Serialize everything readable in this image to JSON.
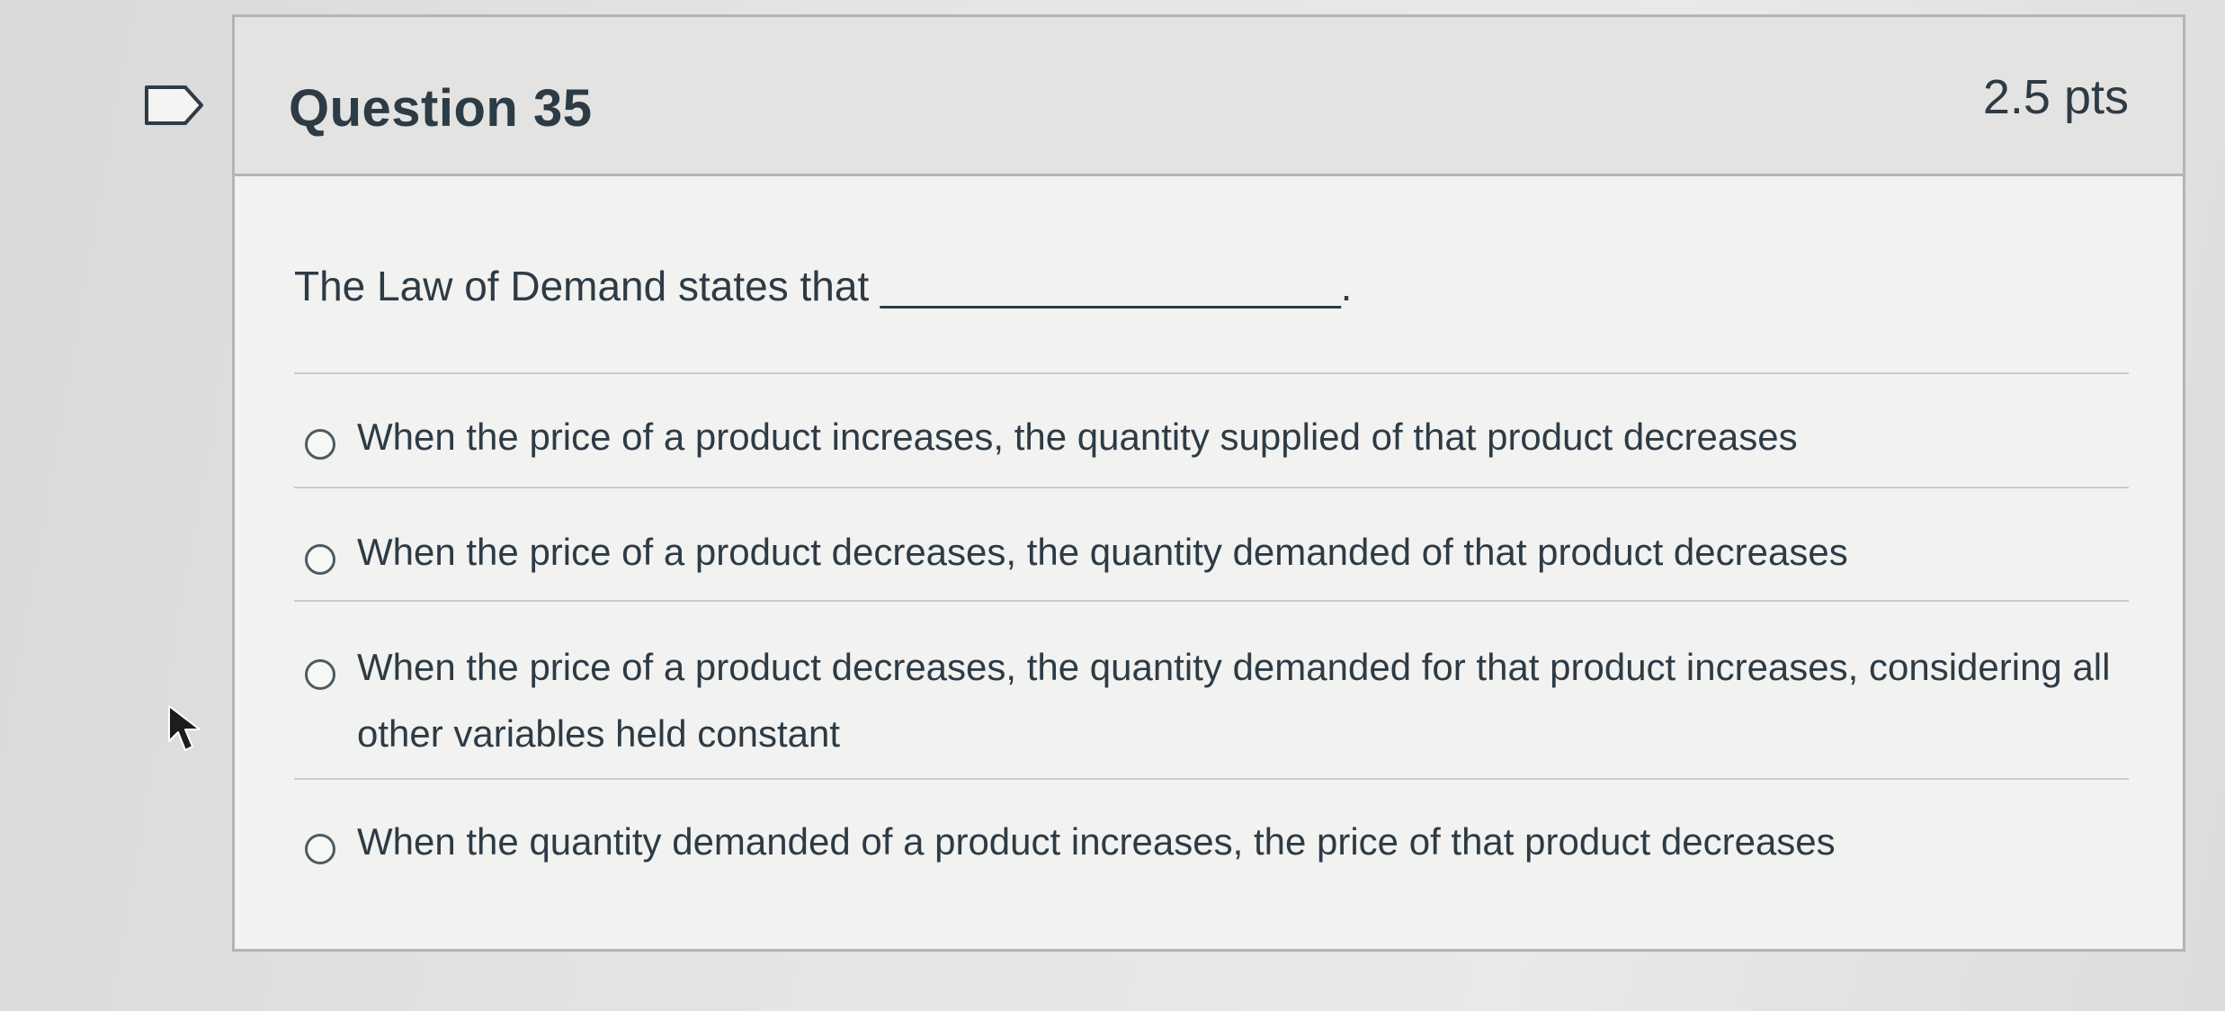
{
  "question": {
    "title": "Question 35",
    "points": "2.5 pts",
    "text": "The Law of Demand states that ____________________."
  },
  "answers": [
    {
      "label": "When the price of a product increases, the quantity supplied of that product decreases"
    },
    {
      "label": "When the price of a product decreases, the quantity demanded of that product decreases"
    },
    {
      "label": "When the price of a product decreases, the quantity demanded for that product increases, considering all other variables held constant"
    },
    {
      "label": "When the quantity demanded of a product increases, the price of that product decreases"
    }
  ],
  "icons": {
    "flag": "flag-icon",
    "cursor": "mouse-pointer-icon",
    "radio": "radio-button-icon"
  },
  "colors": {
    "text": "#2d3b45",
    "border": "#b2b4b6",
    "header_bg": "#e3e3e2",
    "card_bg": "#f2f2f1"
  }
}
